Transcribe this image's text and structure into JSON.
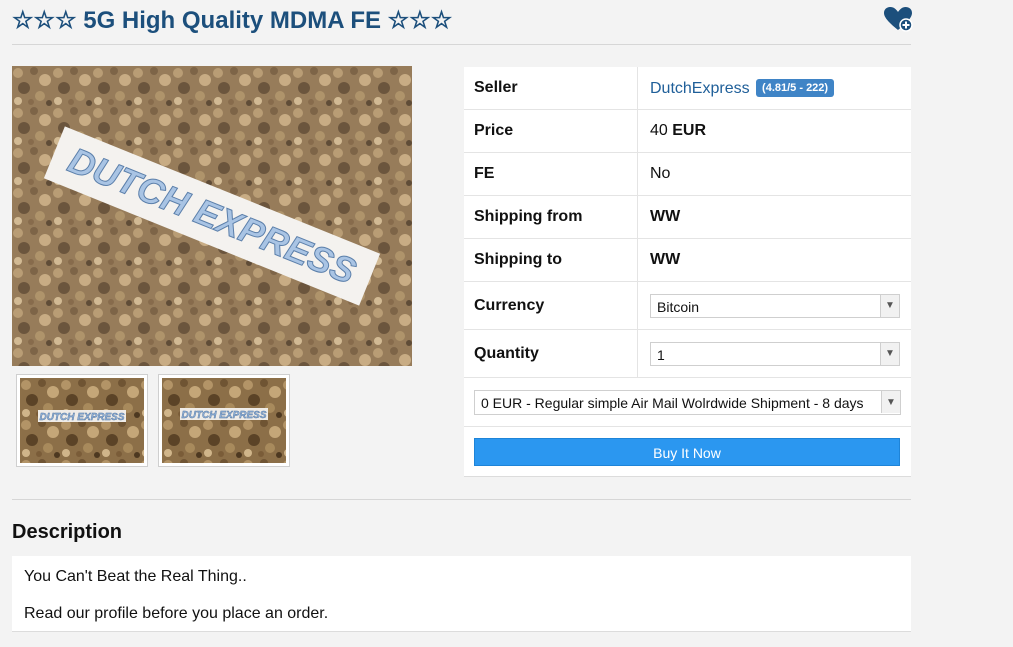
{
  "listing": {
    "title": "☆☆☆ 5G High Quality MDMA FE ☆☆☆",
    "favorite_icon": "heart-plus-icon"
  },
  "images": {
    "main_watermark": "DUTCH EXPRESS",
    "thumbnails": [
      {
        "watermark": "DUTCH EXPRESS"
      },
      {
        "watermark": "DUTCH EXPRESS"
      }
    ]
  },
  "details": {
    "seller": {
      "label": "Seller",
      "name": "DutchExpress",
      "rating": "(4.81/5 - 222)"
    },
    "price": {
      "label": "Price",
      "amount": "40",
      "currency": "EUR"
    },
    "fe": {
      "label": "FE",
      "value": "No"
    },
    "shipping_from": {
      "label": "Shipping from",
      "value": "WW"
    },
    "shipping_to": {
      "label": "Shipping to",
      "value": "WW"
    },
    "currency": {
      "label": "Currency",
      "selected": "Bitcoin"
    },
    "quantity": {
      "label": "Quantity",
      "selected": "1"
    },
    "shipping_option": {
      "selected": "0 EUR - Regular simple Air Mail Wolrdwide Shipment - 8 days"
    },
    "buy_label": "Buy It Now"
  },
  "description": {
    "heading": "Description",
    "lines": [
      "You Can't Beat the Real Thing..",
      "Read our profile before you place an order."
    ]
  },
  "colors": {
    "title": "#1c4f7c",
    "badge": "#3f84c6",
    "buy_button": "#2b97f0",
    "link": "#1f5f99"
  }
}
